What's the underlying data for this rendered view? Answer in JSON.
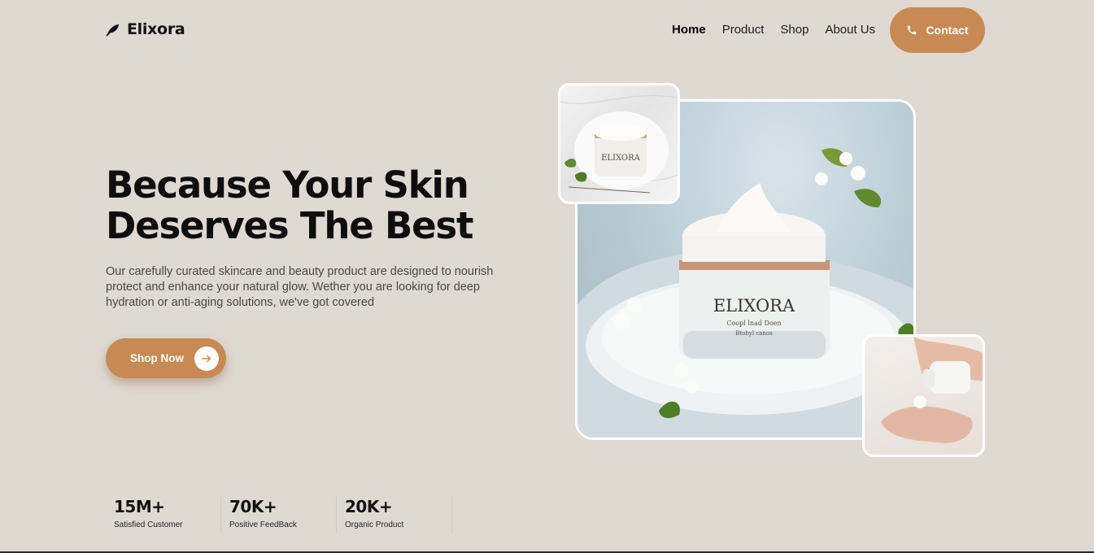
{
  "brand": {
    "name": "Elixora",
    "accent": "#c68a52",
    "background": "#e0d9d2"
  },
  "nav": {
    "items": [
      {
        "label": "Home",
        "active": true
      },
      {
        "label": "Product",
        "active": false
      },
      {
        "label": "Shop",
        "active": false
      },
      {
        "label": "About Us",
        "active": false
      }
    ],
    "contact_label": "Contact",
    "contact_icon": "phone-icon"
  },
  "hero": {
    "title_line1": "Because Your Skin",
    "title_line2": "Deserves The Best",
    "description": "Our carefully curated skincare and beauty product are designed to nourish protect and enhance your natural glow. Wether you are looking for deep hydration or anti-aging solutions, we've got covered",
    "cta_label": "Shop Now",
    "cta_icon": "arrow-right-icon"
  },
  "product": {
    "jar_brand": "ELIXORA",
    "jar_line2": "Coopl lnad Doen",
    "jar_line3": "Btobyl canos"
  },
  "stats": [
    {
      "value": "15M+",
      "label": "Satisfied Customer"
    },
    {
      "value": "70K+",
      "label": "Positive FeedBack"
    },
    {
      "value": "20K+",
      "label": "Organic Product"
    }
  ]
}
